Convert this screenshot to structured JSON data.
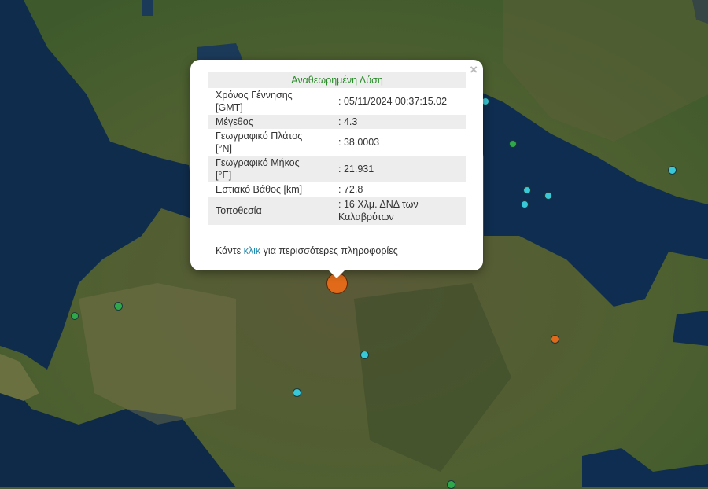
{
  "popup": {
    "title": "Αναθεωρημένη Λύση",
    "close_label": "×",
    "rows": [
      {
        "label_line1": "Χρόνος Γέννησης",
        "label_line2": "[GMT]",
        "value": ": 05/11/2024 00:37:15.02"
      },
      {
        "label_line1": "Μέγεθος",
        "value": ": 4.3"
      },
      {
        "label_line1": "Γεωγραφικό Πλάτος",
        "label_line2": "[°N]",
        "value": ": 38.0003"
      },
      {
        "label_line1": "Γεωγραφικό Μήκος",
        "label_line2": "[°E]",
        "value": ": 21.931"
      },
      {
        "label_line1": "Εστιακό Βάθος [km]",
        "value": ": 72.8"
      },
      {
        "label_line1": "Τοποθεσία",
        "value": ": 16 Χλμ. ΔΝΔ των",
        "value_line2": "Καλαβρύτων"
      }
    ],
    "more_prefix": "Κάντε ",
    "more_link": "κλικ",
    "more_suffix": " για περισσότερες πληροφορίες"
  },
  "colors": {
    "cyan": "#38c8d8",
    "green": "#2ea84a",
    "orange": "#e06a1a",
    "sea": "#0d2a4a"
  }
}
